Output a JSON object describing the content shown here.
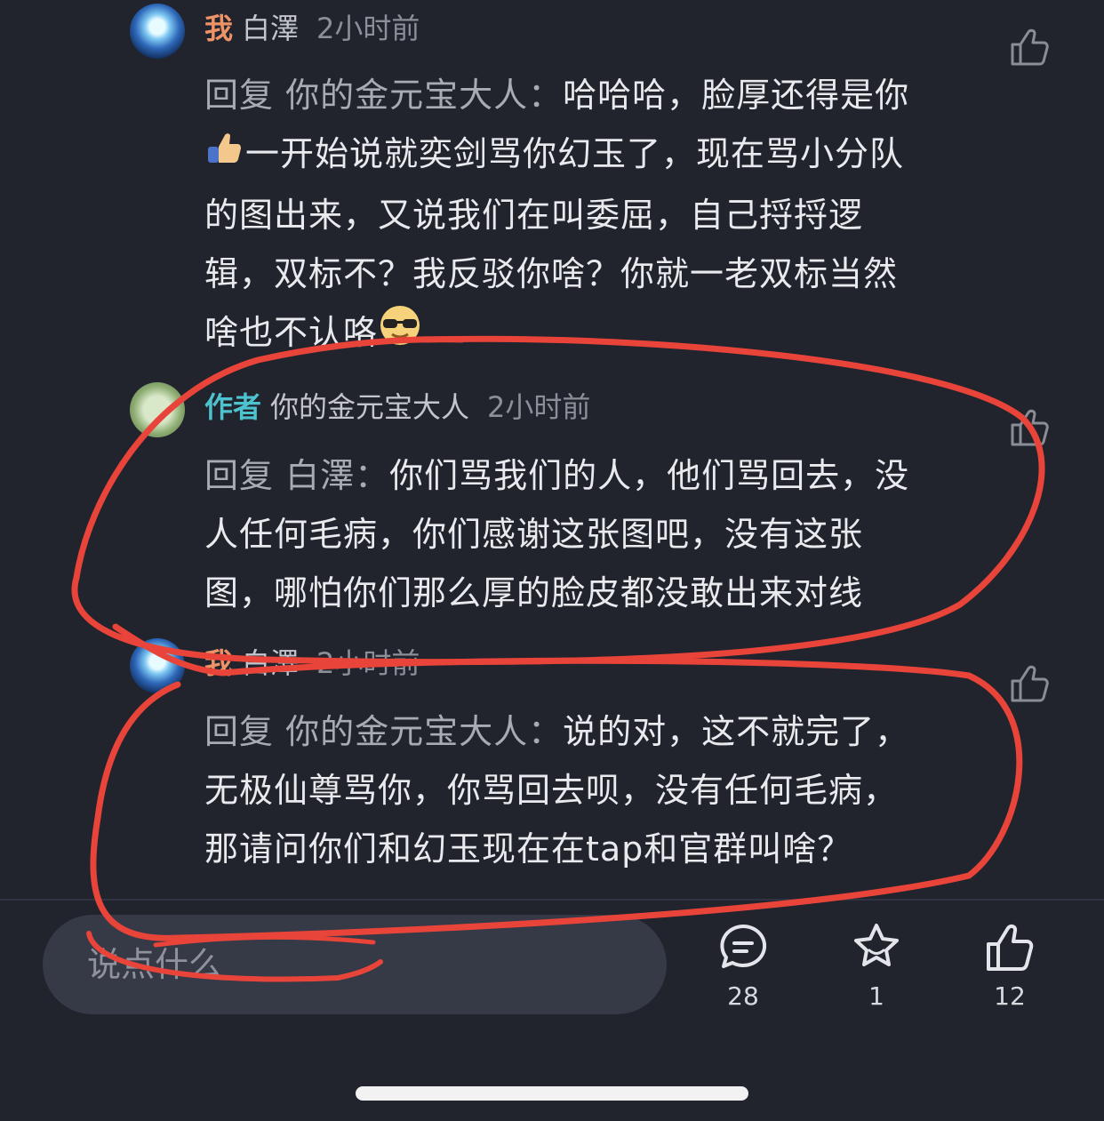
{
  "comments": [
    {
      "tag": "我",
      "username": "白澤",
      "time": "2小时前",
      "reply_prefix": "回复 你的金元宝大人：",
      "lines": [
        "哈哈哈，脸厚还得是你",
        "一开始说就奕剑骂你幻玉了，现在骂小分队",
        "的图出来，又说我们在叫委屈，自己捋捋逻",
        "辑，双标不？我反驳你啥？你就一老双标当然",
        "啥也不认咯"
      ]
    },
    {
      "tag": "作者",
      "username": "你的金元宝大人",
      "time": "2小时前",
      "reply_prefix": "回复 白澤：",
      "lines": [
        "你们骂我们的人，他们骂回去，没",
        "人任何毛病，你们感谢这张图吧，没有这张",
        "图，哪怕你们那么厚的脸皮都没敢出来对线"
      ]
    },
    {
      "tag": "我",
      "username": "白澤",
      "time": "2小时前",
      "reply_prefix": "回复 你的金元宝大人：",
      "lines": [
        "说的对，这不就完了，",
        "无极仙尊骂你，你骂回去呗，没有任何毛病，",
        "那请问你们和幻玉现在在tap和官群叫啥？"
      ]
    }
  ],
  "input": {
    "placeholder": "说点什么"
  },
  "actions": {
    "comment_count": "28",
    "favorite_count": "1",
    "like_count": "12"
  },
  "colors": {
    "background": "#21232d",
    "tag_me": "#ee9268",
    "tag_author": "#4cc3cf",
    "annotation": "#e8443a"
  }
}
